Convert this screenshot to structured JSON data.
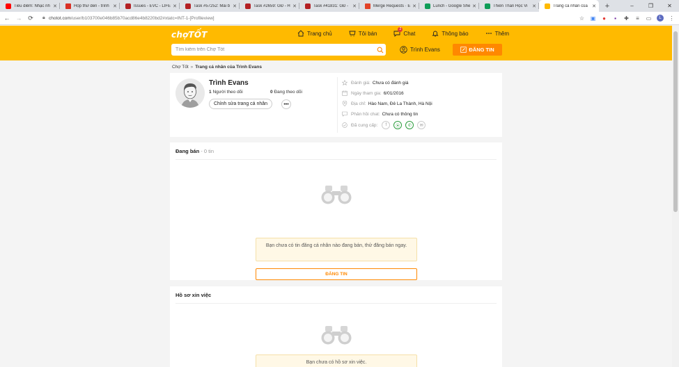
{
  "browser": {
    "tabs": [
      {
        "label": "Tiêu điểm: Nhạc nh",
        "favicon": "youtube-icon",
        "color": "#ff0000"
      },
      {
        "label": "Hộp thư đến - trình",
        "favicon": "gmail-icon",
        "color": "#d93025"
      },
      {
        "label": "Issues - EVC - LIFET",
        "favicon": "redmine-icon",
        "color": "#b32024"
      },
      {
        "label": "Task #57252: Mái b",
        "favicon": "redmine-icon",
        "color": "#b32024"
      },
      {
        "label": "Task #2659: GĐ - H",
        "favicon": "redmine-icon",
        "color": "#b32024"
      },
      {
        "label": "Task #41831: GĐ -",
        "favicon": "redmine-icon",
        "color": "#b32024"
      },
      {
        "label": "Merge Requests · E",
        "favicon": "gitlab-icon",
        "color": "#e24329"
      },
      {
        "label": "Lunch - Google She",
        "favicon": "sheets-icon",
        "color": "#0f9d58"
      },
      {
        "label": "Thiên Thần Học Vi",
        "favicon": "sheets-icon",
        "color": "#0f9d58"
      },
      {
        "label": "Trang cá nhân của",
        "favicon": "chotot-icon",
        "color": "#ffba00",
        "active": true
      }
    ],
    "new_tab": "+",
    "window_controls": [
      "–",
      "❐",
      "✕"
    ],
    "url_host": "chotot.com",
    "url_path": "/user/b103700e046b85b70acd86e4b8220bd2#xtatc=INT-1-[Profileview]"
  },
  "header": {
    "logo": "chợTỐT",
    "nav": [
      {
        "label": "Trang chủ",
        "icon": "home-icon"
      },
      {
        "label": "Tôi bán",
        "icon": "basket-icon"
      },
      {
        "label": "Chat",
        "icon": "chat-icon",
        "badge": "2"
      },
      {
        "label": "Thông báo",
        "icon": "bell-icon"
      },
      {
        "label": "Thêm",
        "icon": "more-dots-icon"
      }
    ],
    "search_placeholder": "Tìm kiếm trên Chợ Tốt",
    "user_name": "Trình Evans",
    "post_label": "ĐĂNG TIN"
  },
  "breadcrumb": {
    "home": "Chợ Tốt",
    "separator": "»",
    "current": "Trang cá nhân của Trình Evans"
  },
  "profile": {
    "name": "Trình Evans",
    "followers_count": "1",
    "followers_label": "Người theo dõi",
    "following_count": "0",
    "following_label": "Đang theo dõi",
    "edit_label": "Chỉnh sửa trang cá nhân",
    "more_label": "•••",
    "info": {
      "rating_label": "Đánh giá:",
      "rating_value": "Chưa có đánh giá",
      "joined_label": "Ngày tham gia:",
      "joined_value": "6/01/2016",
      "address_label": "Địa chỉ:",
      "address_value": "Hào Nam, Đê La Thành, Hà Nội",
      "chat_label": "Phản hồi chat:",
      "chat_value": "Chưa có thông tin",
      "provided_label": "Đã cung cấp:"
    }
  },
  "selling": {
    "title": "Đang bán",
    "count": "- 0 tin",
    "empty_text": "Bạn chưa có tin đăng cá nhân nào đang bán, thử đăng bán ngay.",
    "button": "ĐĂNG TIN"
  },
  "cv": {
    "title": "Hồ sơ xin việc",
    "empty_text": "Bạn chưa có hồ sơ xin việc."
  },
  "colors": {
    "brand_yellow": "#ffba00",
    "accent_orange": "#ff8800",
    "verified_green": "#2e9e3f"
  }
}
